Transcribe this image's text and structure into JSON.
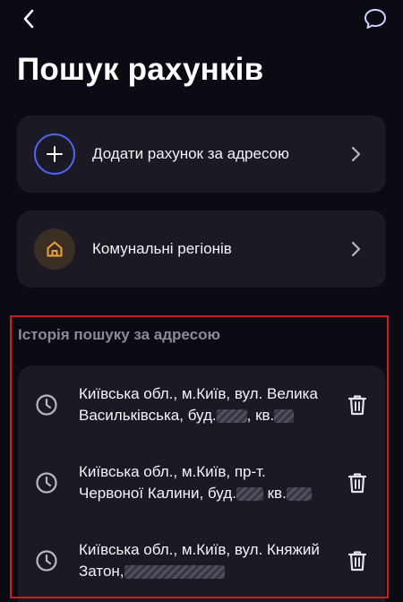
{
  "header": {
    "title": "Пошук рахунків",
    "back_icon": "chevron-left-icon",
    "chat_icon": "chat-bubble-icon"
  },
  "cards": [
    {
      "label": "Додати рахунок за адресою",
      "icon": "plus-icon",
      "accent": "#4f63f0"
    },
    {
      "label": "Комунальні регіонів",
      "icon": "home-icon",
      "accent": "#f0a23c"
    }
  ],
  "history": {
    "title": "Історія пошуку за адресою",
    "items": [
      {
        "line1": "Київська обл., м.Київ, вул. Велика",
        "line2a": "Васильківська, буд.",
        "line2b": ", кв."
      },
      {
        "line1": "Київська обл., м.Київ, пр-т.",
        "line2a": "Червоної Калини, буд.",
        "line2b": " кв."
      },
      {
        "line1": "Київська обл., м.Київ, вул. Княжий",
        "line2a": "Затон,",
        "line2b": ""
      }
    ]
  },
  "colors": {
    "background": "#0b0b14",
    "card": "#1b1a24",
    "highlight_border": "#d11a22"
  }
}
